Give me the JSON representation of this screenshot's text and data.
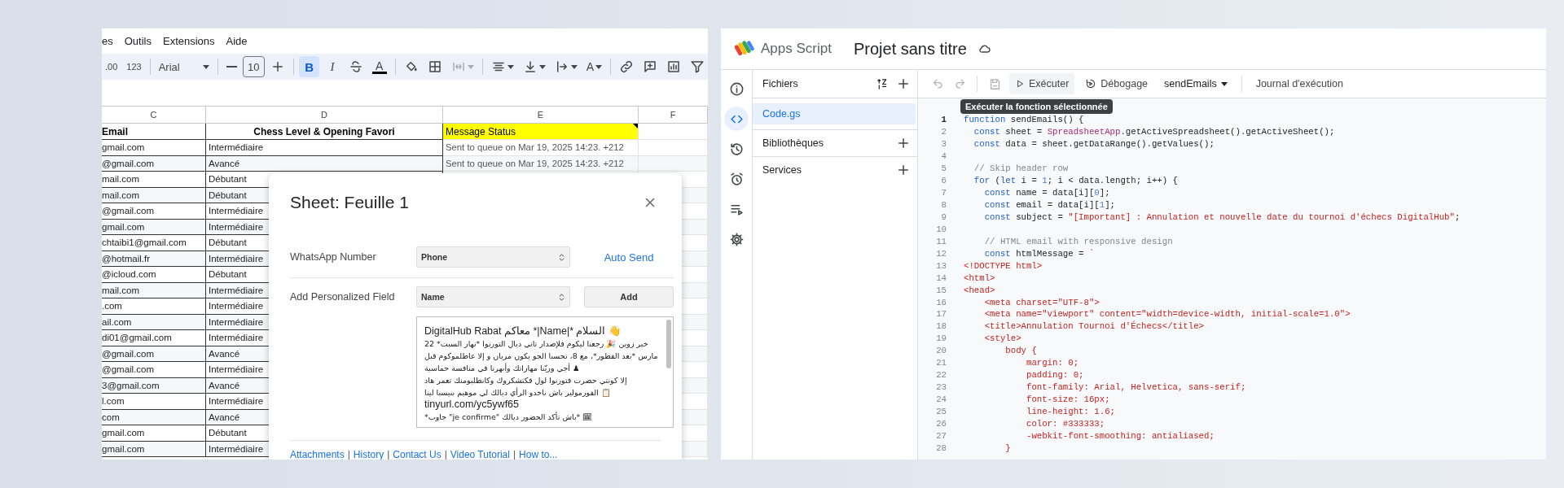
{
  "spreadsheet": {
    "menu": [
      "es",
      "Outils",
      "Extensions",
      "Aide"
    ],
    "toolbar": [
      {
        "kind": "text",
        "label": ".00"
      },
      {
        "kind": "text",
        "label": "123"
      },
      {
        "kind": "sep"
      },
      {
        "kind": "font",
        "label": "Arial"
      },
      {
        "kind": "sep"
      },
      {
        "kind": "minus"
      },
      {
        "kind": "size",
        "label": "10"
      },
      {
        "kind": "plus"
      },
      {
        "kind": "sep"
      },
      {
        "kind": "bold",
        "label": "B",
        "on": true
      },
      {
        "kind": "italic",
        "label": "I",
        "on": false
      },
      {
        "kind": "strike",
        "on": false
      },
      {
        "kind": "textcolor",
        "label": "A"
      },
      {
        "kind": "sep"
      },
      {
        "kind": "fill"
      },
      {
        "kind": "borders"
      },
      {
        "kind": "merge",
        "disabled": true
      },
      {
        "kind": "sep"
      },
      {
        "kind": "halign"
      },
      {
        "kind": "valign"
      },
      {
        "kind": "wrap"
      },
      {
        "kind": "rotate",
        "label": "A"
      },
      {
        "kind": "sep"
      },
      {
        "kind": "link"
      },
      {
        "kind": "comment"
      },
      {
        "kind": "chart"
      },
      {
        "kind": "filter"
      }
    ],
    "columns": [
      "C",
      "D",
      "E",
      "F"
    ],
    "header": {
      "column_c": "Email",
      "column_d": "Chess Level & Opening Favori",
      "column_e": "Message Status"
    },
    "rows": [
      {
        "column_c": "gmail.com",
        "column_d": "Intermédiaire",
        "column_e": "Sent to queue on Mar 19, 2025 14:23. +212"
      },
      {
        "column_c": "@gmail.com",
        "column_d": "Avancé",
        "column_e": "Sent to queue on Mar 19, 2025 14:23. +212"
      },
      {
        "column_c": "mail.com",
        "column_d": "Débutant"
      },
      {
        "column_c": "mail.com",
        "column_d": "Débutant"
      },
      {
        "column_c": "@gmail.com",
        "column_d": "Intermédiaire"
      },
      {
        "column_c": "gmail.com",
        "column_d": "Intermédiaire"
      },
      {
        "column_c": "chtaibi1@gmail.com",
        "column_d": "Débutant"
      },
      {
        "column_c": "@hotmail.fr",
        "column_d": "Intermédiaire"
      },
      {
        "column_c": "@icloud.com",
        "column_d": "Débutant"
      },
      {
        "column_c": "mail.com",
        "column_d": "Intermédiaire"
      },
      {
        "column_c": ".com",
        "column_d": "Intermédiaire"
      },
      {
        "column_c": "ail.com",
        "column_d": "Intermédiaire"
      },
      {
        "column_c": "di01@gmail.com",
        "column_d": "Intermédiaire"
      },
      {
        "column_c": "@gmail.com",
        "column_d": "Avancé"
      },
      {
        "column_c": "@gmail.com",
        "column_d": "Intermédiaire"
      },
      {
        "column_c": "3@gmail.com",
        "column_d": "Avancé"
      },
      {
        "column_c": "l.com",
        "column_d": "Intermédiaire"
      },
      {
        "column_c": "com",
        "column_d": "Avancé"
      },
      {
        "column_c": "gmail.com",
        "column_d": "Débutant"
      },
      {
        "column_c": "gmail.com",
        "column_d": "Intermédiaire"
      }
    ]
  },
  "dialog": {
    "title": "Sheet: Feuille 1",
    "whatsapp_label": "WhatsApp Number",
    "whatsapp_select": "Phone",
    "auto_send": "Auto Send",
    "field_label": "Add Personalized Field",
    "field_select": "Name",
    "add_button": "Add",
    "message_lines": [
      "👋 السلام *|Name|* معاكم DigitalHub Rabat",
      "خبر زوين 🎉 رجعنا ليكوم فلإصدار تاني ديال التورنوا *نهار السبت* 22",
      "مارس *بعد الفطور*، مع 8، تحسبا الجو يكون مزيان و إلا عاطلموكوم قبل",
      "♟ أجي وريّنا مهاراتك وأبهرنا في منافسة حماسية",
      "إلا كونتي حضرت فتورنوا لول فكتشكروك وكانطلبومنك تعمر هاد",
      "📋 الفورمولير باش ناخدو الرأي ديالك لي موهيم بنيسبا لينا",
      "tinyurl.com/yc5ywf65",
      "🗓 *باش تأكد الحضور ديالك \"je confirme\" جاوب*"
    ],
    "footer_links": [
      "Attachments",
      "History",
      "Contact Us",
      "Video Tutorial",
      "How to..."
    ],
    "footer_separators": [
      "|",
      "|",
      "|",
      "|"
    ]
  },
  "editor": {
    "app_name": "Apps Script",
    "project_title": "Projet sans titre",
    "rail": [
      {
        "kind": "info",
        "selected": false
      },
      {
        "kind": "code",
        "selected": true
      },
      {
        "kind": "history",
        "selected": false
      },
      {
        "kind": "triggers",
        "selected": false
      },
      {
        "kind": "executions",
        "selected": false
      },
      {
        "kind": "settings",
        "selected": false
      }
    ],
    "files_title": "Fichiers",
    "files": [
      {
        "name": "Code.gs",
        "selected": true
      }
    ],
    "sections": [
      "Bibliothèques",
      "Services"
    ],
    "toolbar": {
      "run": "Exécuter",
      "debug": "Débogage",
      "function_name": "sendEmails",
      "log": "Journal d'exécution"
    },
    "tooltip": "Exécuter la fonction sélectionnée",
    "code_lines": [
      {
        "number": "1",
        "current": true,
        "tokens": [
          {
            "kind": "keyword",
            "text": "function"
          },
          {
            "kind": "plain",
            "text": " sendEmails() {"
          }
        ]
      },
      {
        "number": "2",
        "current": false,
        "tokens": [
          {
            "kind": "keyword",
            "text": "  const"
          },
          {
            "kind": "plain",
            "text": " sheet = "
          },
          {
            "kind": "class",
            "text": "SpreadsheetApp"
          },
          {
            "kind": "plain",
            "text": ".getActiveSpreadsheet().getActiveSheet();"
          }
        ]
      },
      {
        "number": "3",
        "current": false,
        "tokens": [
          {
            "kind": "keyword",
            "text": "  const"
          },
          {
            "kind": "plain",
            "text": " data = sheet.getDataRange().getValues();"
          }
        ]
      },
      {
        "number": "4",
        "current": false
      },
      {
        "number": "5",
        "current": false,
        "tokens": [
          {
            "kind": "comment",
            "text": "  // Skip header row"
          }
        ]
      },
      {
        "number": "6",
        "current": false,
        "tokens": [
          {
            "kind": "keyword",
            "text": "  for"
          },
          {
            "kind": "plain",
            "text": " ("
          },
          {
            "kind": "keyword",
            "text": "let"
          },
          {
            "kind": "plain",
            "text": " i = "
          },
          {
            "kind": "number",
            "text": "1"
          },
          {
            "kind": "plain",
            "text": "; i < data.length; i++) {"
          }
        ]
      },
      {
        "number": "7",
        "current": false,
        "tokens": [
          {
            "kind": "keyword",
            "text": "    const"
          },
          {
            "kind": "plain",
            "text": " name = data[i]["
          },
          {
            "kind": "number",
            "text": "0"
          },
          {
            "kind": "plain",
            "text": "];"
          }
        ]
      },
      {
        "number": "8",
        "current": false,
        "tokens": [
          {
            "kind": "keyword",
            "text": "    const"
          },
          {
            "kind": "plain",
            "text": " email = data[i]["
          },
          {
            "kind": "number",
            "text": "1"
          },
          {
            "kind": "plain",
            "text": "];"
          }
        ]
      },
      {
        "number": "9",
        "current": false,
        "tokens": [
          {
            "kind": "keyword",
            "text": "    const"
          },
          {
            "kind": "plain",
            "text": " subject = "
          },
          {
            "kind": "string",
            "text": "\"[Important] : Annulation et nouvelle date du tournoi d'échecs DigitalHub\""
          },
          {
            "kind": "plain",
            "text": ";"
          }
        ]
      },
      {
        "number": "10",
        "current": false
      },
      {
        "number": "11",
        "current": false,
        "tokens": [
          {
            "kind": "comment",
            "text": "    // HTML email with responsive design"
          }
        ]
      },
      {
        "number": "12",
        "current": false,
        "tokens": [
          {
            "kind": "keyword",
            "text": "    const"
          },
          {
            "kind": "plain",
            "text": " htmlMessage = "
          },
          {
            "kind": "string",
            "text": "`"
          }
        ]
      },
      {
        "number": "13",
        "current": false,
        "tokens": [
          {
            "kind": "string",
            "text": "<!DOCTYPE html>"
          }
        ]
      },
      {
        "number": "14",
        "current": false,
        "tokens": [
          {
            "kind": "string",
            "text": "<html>"
          }
        ]
      },
      {
        "number": "15",
        "current": false,
        "tokens": [
          {
            "kind": "string",
            "text": "<head>"
          }
        ]
      },
      {
        "number": "16",
        "current": false,
        "tokens": [
          {
            "kind": "string",
            "text": "    <meta charset=\"UTF-8\">"
          }
        ]
      },
      {
        "number": "17",
        "current": false,
        "tokens": [
          {
            "kind": "string",
            "text": "    <meta name=\"viewport\" content=\"width=device-width, initial-scale=1.0\">"
          }
        ]
      },
      {
        "number": "18",
        "current": false,
        "tokens": [
          {
            "kind": "string",
            "text": "    <title>Annulation Tournoi d'Échecs</title>"
          }
        ]
      },
      {
        "number": "19",
        "current": false,
        "tokens": [
          {
            "kind": "string",
            "text": "    <style>"
          }
        ]
      },
      {
        "number": "20",
        "current": false,
        "tokens": [
          {
            "kind": "string",
            "text": "        body {"
          }
        ]
      },
      {
        "number": "21",
        "current": false,
        "tokens": [
          {
            "kind": "string",
            "text": "            margin: 0;"
          }
        ]
      },
      {
        "number": "22",
        "current": false,
        "tokens": [
          {
            "kind": "string",
            "text": "            padding: 0;"
          }
        ]
      },
      {
        "number": "23",
        "current": false,
        "tokens": [
          {
            "kind": "string",
            "text": "            font-family: Arial, Helvetica, sans-serif;"
          }
        ]
      },
      {
        "number": "24",
        "current": false,
        "tokens": [
          {
            "kind": "string",
            "text": "            font-size: 16px;"
          }
        ]
      },
      {
        "number": "25",
        "current": false,
        "tokens": [
          {
            "kind": "string",
            "text": "            line-height: 1.6;"
          }
        ]
      },
      {
        "number": "26",
        "current": false,
        "tokens": [
          {
            "kind": "string",
            "text": "            color: #333333;"
          }
        ]
      },
      {
        "number": "27",
        "current": false,
        "tokens": [
          {
            "kind": "string",
            "text": "            -webkit-font-smoothing: antialiased;"
          }
        ]
      },
      {
        "number": "28",
        "current": false,
        "tokens": [
          {
            "kind": "string",
            "text": "        }"
          }
        ]
      }
    ]
  }
}
